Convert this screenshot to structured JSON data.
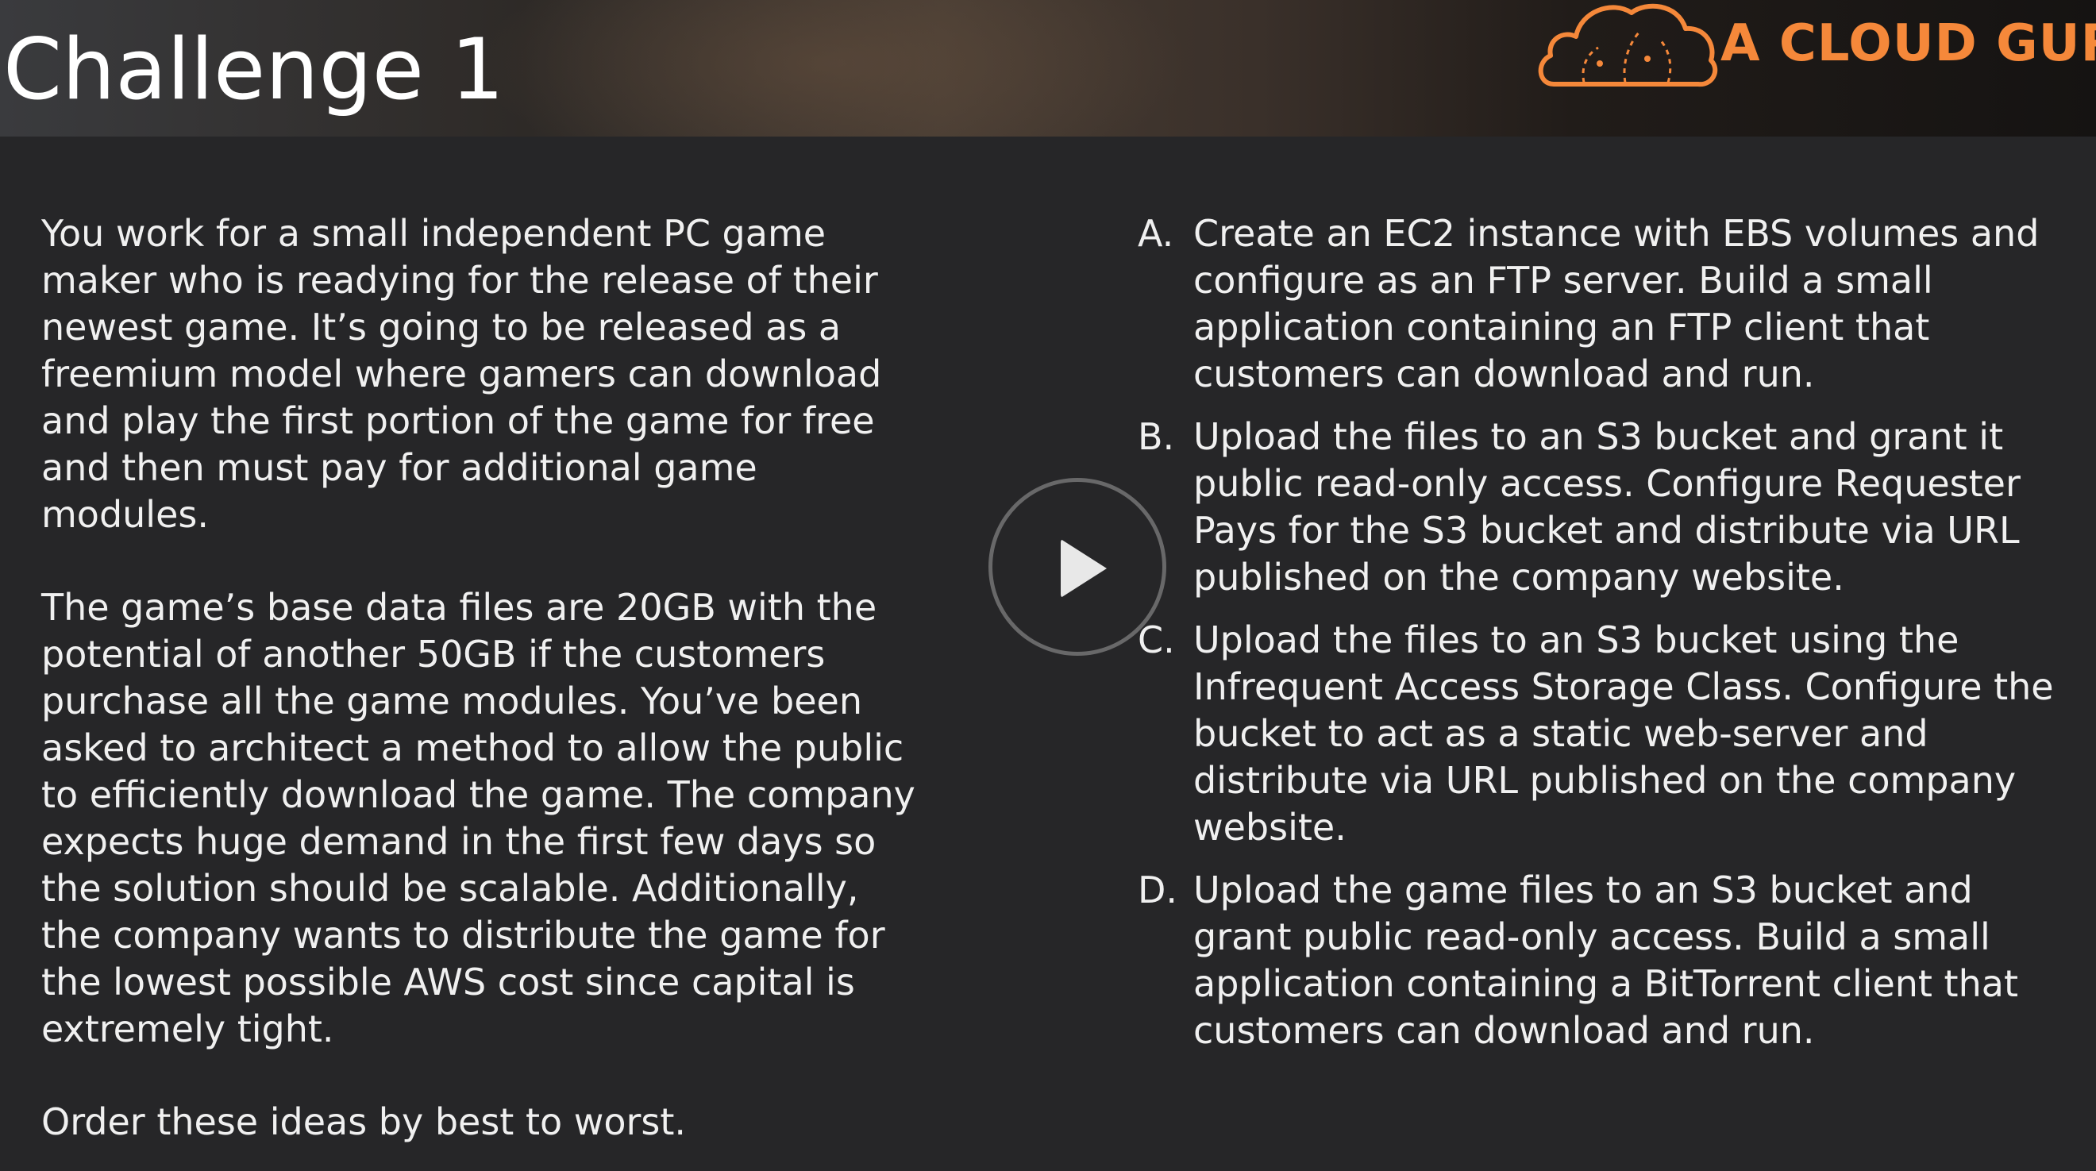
{
  "slide": {
    "title": "Challenge 1"
  },
  "brand": {
    "logo_text": "A CLOUD GURU",
    "accent_color": "#f5883a"
  },
  "question": {
    "paragraphs": [
      "You work for a small independent PC game maker who is readying for the release of their newest game.  It’s going to be released as a freemium model where gamers can download and play the first portion of the game for free and then must pay for additional game modules.",
      "The game’s base data files are 20GB with the potential of another 50GB if the customers purchase all the game modules.  You’ve been asked to architect a method to allow the public to efficiently download the game.  The company expects huge demand in the first few days so the solution should be scalable.  Additionally, the company wants to distribute the game for the lowest possible AWS cost since capital is extremely tight.",
      "Order these ideas by best to worst."
    ]
  },
  "options": [
    {
      "letter": "A.",
      "text": "Create an EC2 instance with EBS volumes and configure as an FTP server.  Build a small application containing an FTP client that customers can download and run."
    },
    {
      "letter": "B.",
      "text": "Upload the files to an S3 bucket and grant it public read-only access.  Configure Requester Pays for the S3 bucket and distribute via URL published on the company website."
    },
    {
      "letter": "C.",
      "text": "Upload the files to an S3 bucket using the Infrequent Access Storage Class.  Configure the bucket to act as a static web-server and distribute via URL published on the company website."
    },
    {
      "letter": "D.",
      "text": "Upload the game files to an S3 bucket and grant public read-only access.  Build a small application containing a BitTorrent client that customers can download and run."
    }
  ],
  "player": {
    "play_icon": "play-icon"
  }
}
